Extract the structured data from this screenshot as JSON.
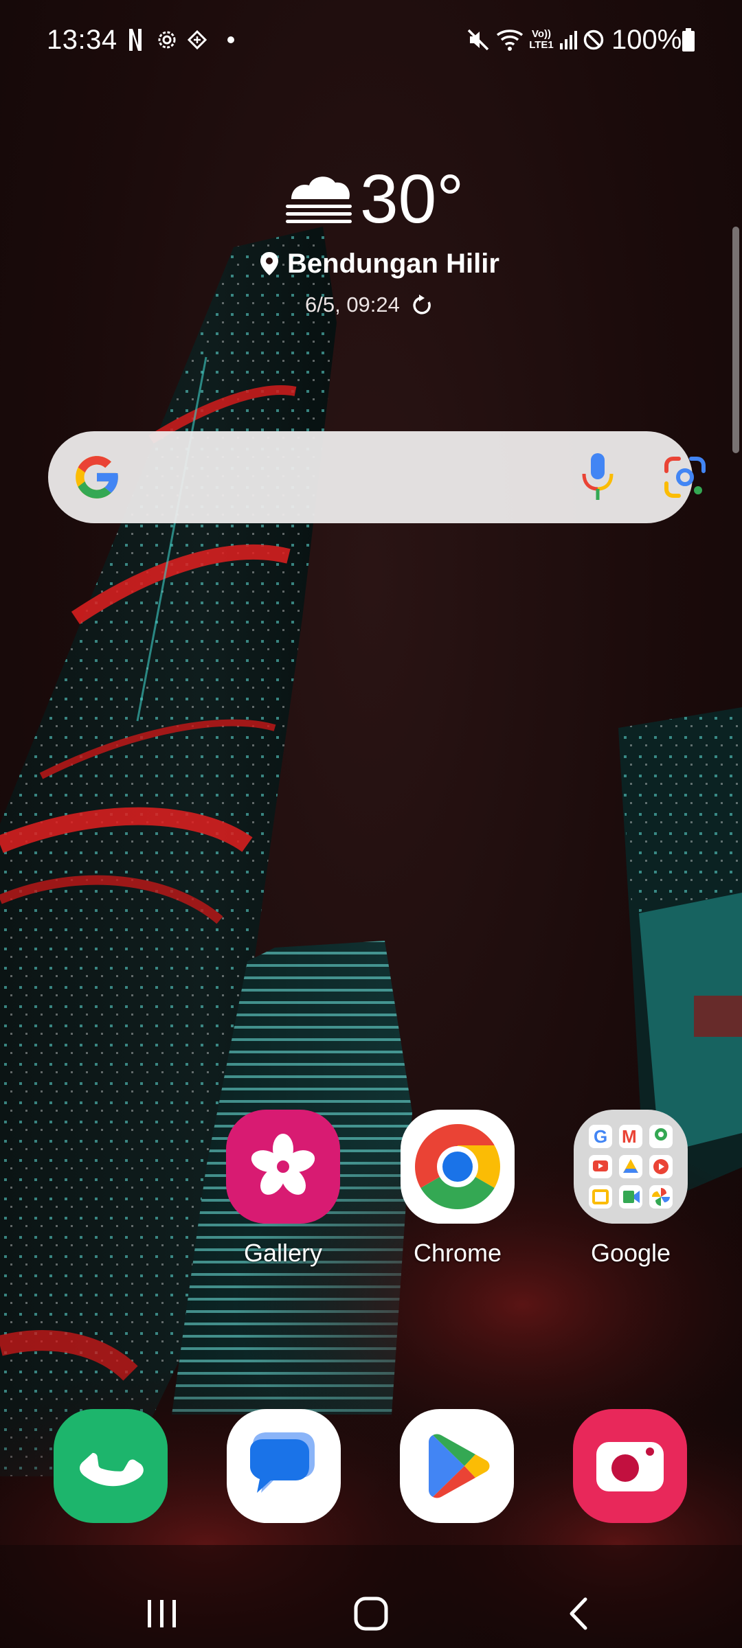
{
  "status_bar": {
    "time": "13:34",
    "battery_percent": "100%",
    "network_label_top": "Vo))",
    "network_label_bottom": "LTE1",
    "icons": [
      "netflix-icon",
      "settings-gear-icon",
      "tinder-like-icon",
      "notification-dot-icon",
      "mute-icon",
      "wifi-icon",
      "volte-icon",
      "signal-icon",
      "do-not-disturb-icon",
      "battery-icon"
    ]
  },
  "weather": {
    "temperature": "30°",
    "location": "Bendungan Hilir",
    "updated": "6/5, 09:24",
    "condition_icon": "cloudy-fog-icon"
  },
  "search": {
    "provider_icon": "google-logo-icon",
    "voice_icon": "mic-icon",
    "lens_icon": "google-lens-icon"
  },
  "apps": [
    {
      "label": "Gallery",
      "icon": "gallery-flower-icon",
      "color": "#d81b72"
    },
    {
      "label": "Chrome",
      "icon": "chrome-icon",
      "color": "#ffffff"
    },
    {
      "label": "Google",
      "icon": "google-folder-icon",
      "color": "#d7d7d7"
    }
  ],
  "dock": [
    {
      "name": "Phone",
      "icon": "phone-icon",
      "color": "#1db56c"
    },
    {
      "name": "Messages",
      "icon": "messages-icon",
      "color": "#ffffff"
    },
    {
      "name": "Play Store",
      "icon": "play-store-icon",
      "color": "#ffffff"
    },
    {
      "name": "Camera",
      "icon": "camera-icon",
      "color": "#e8285a"
    }
  ],
  "navigation": {
    "recents_icon": "recents-icon",
    "home_icon": "home-icon",
    "back_icon": "back-icon"
  },
  "colors": {
    "google_blue": "#4285F4",
    "google_red": "#EA4335",
    "google_yellow": "#FBBC05",
    "google_green": "#34A853"
  }
}
